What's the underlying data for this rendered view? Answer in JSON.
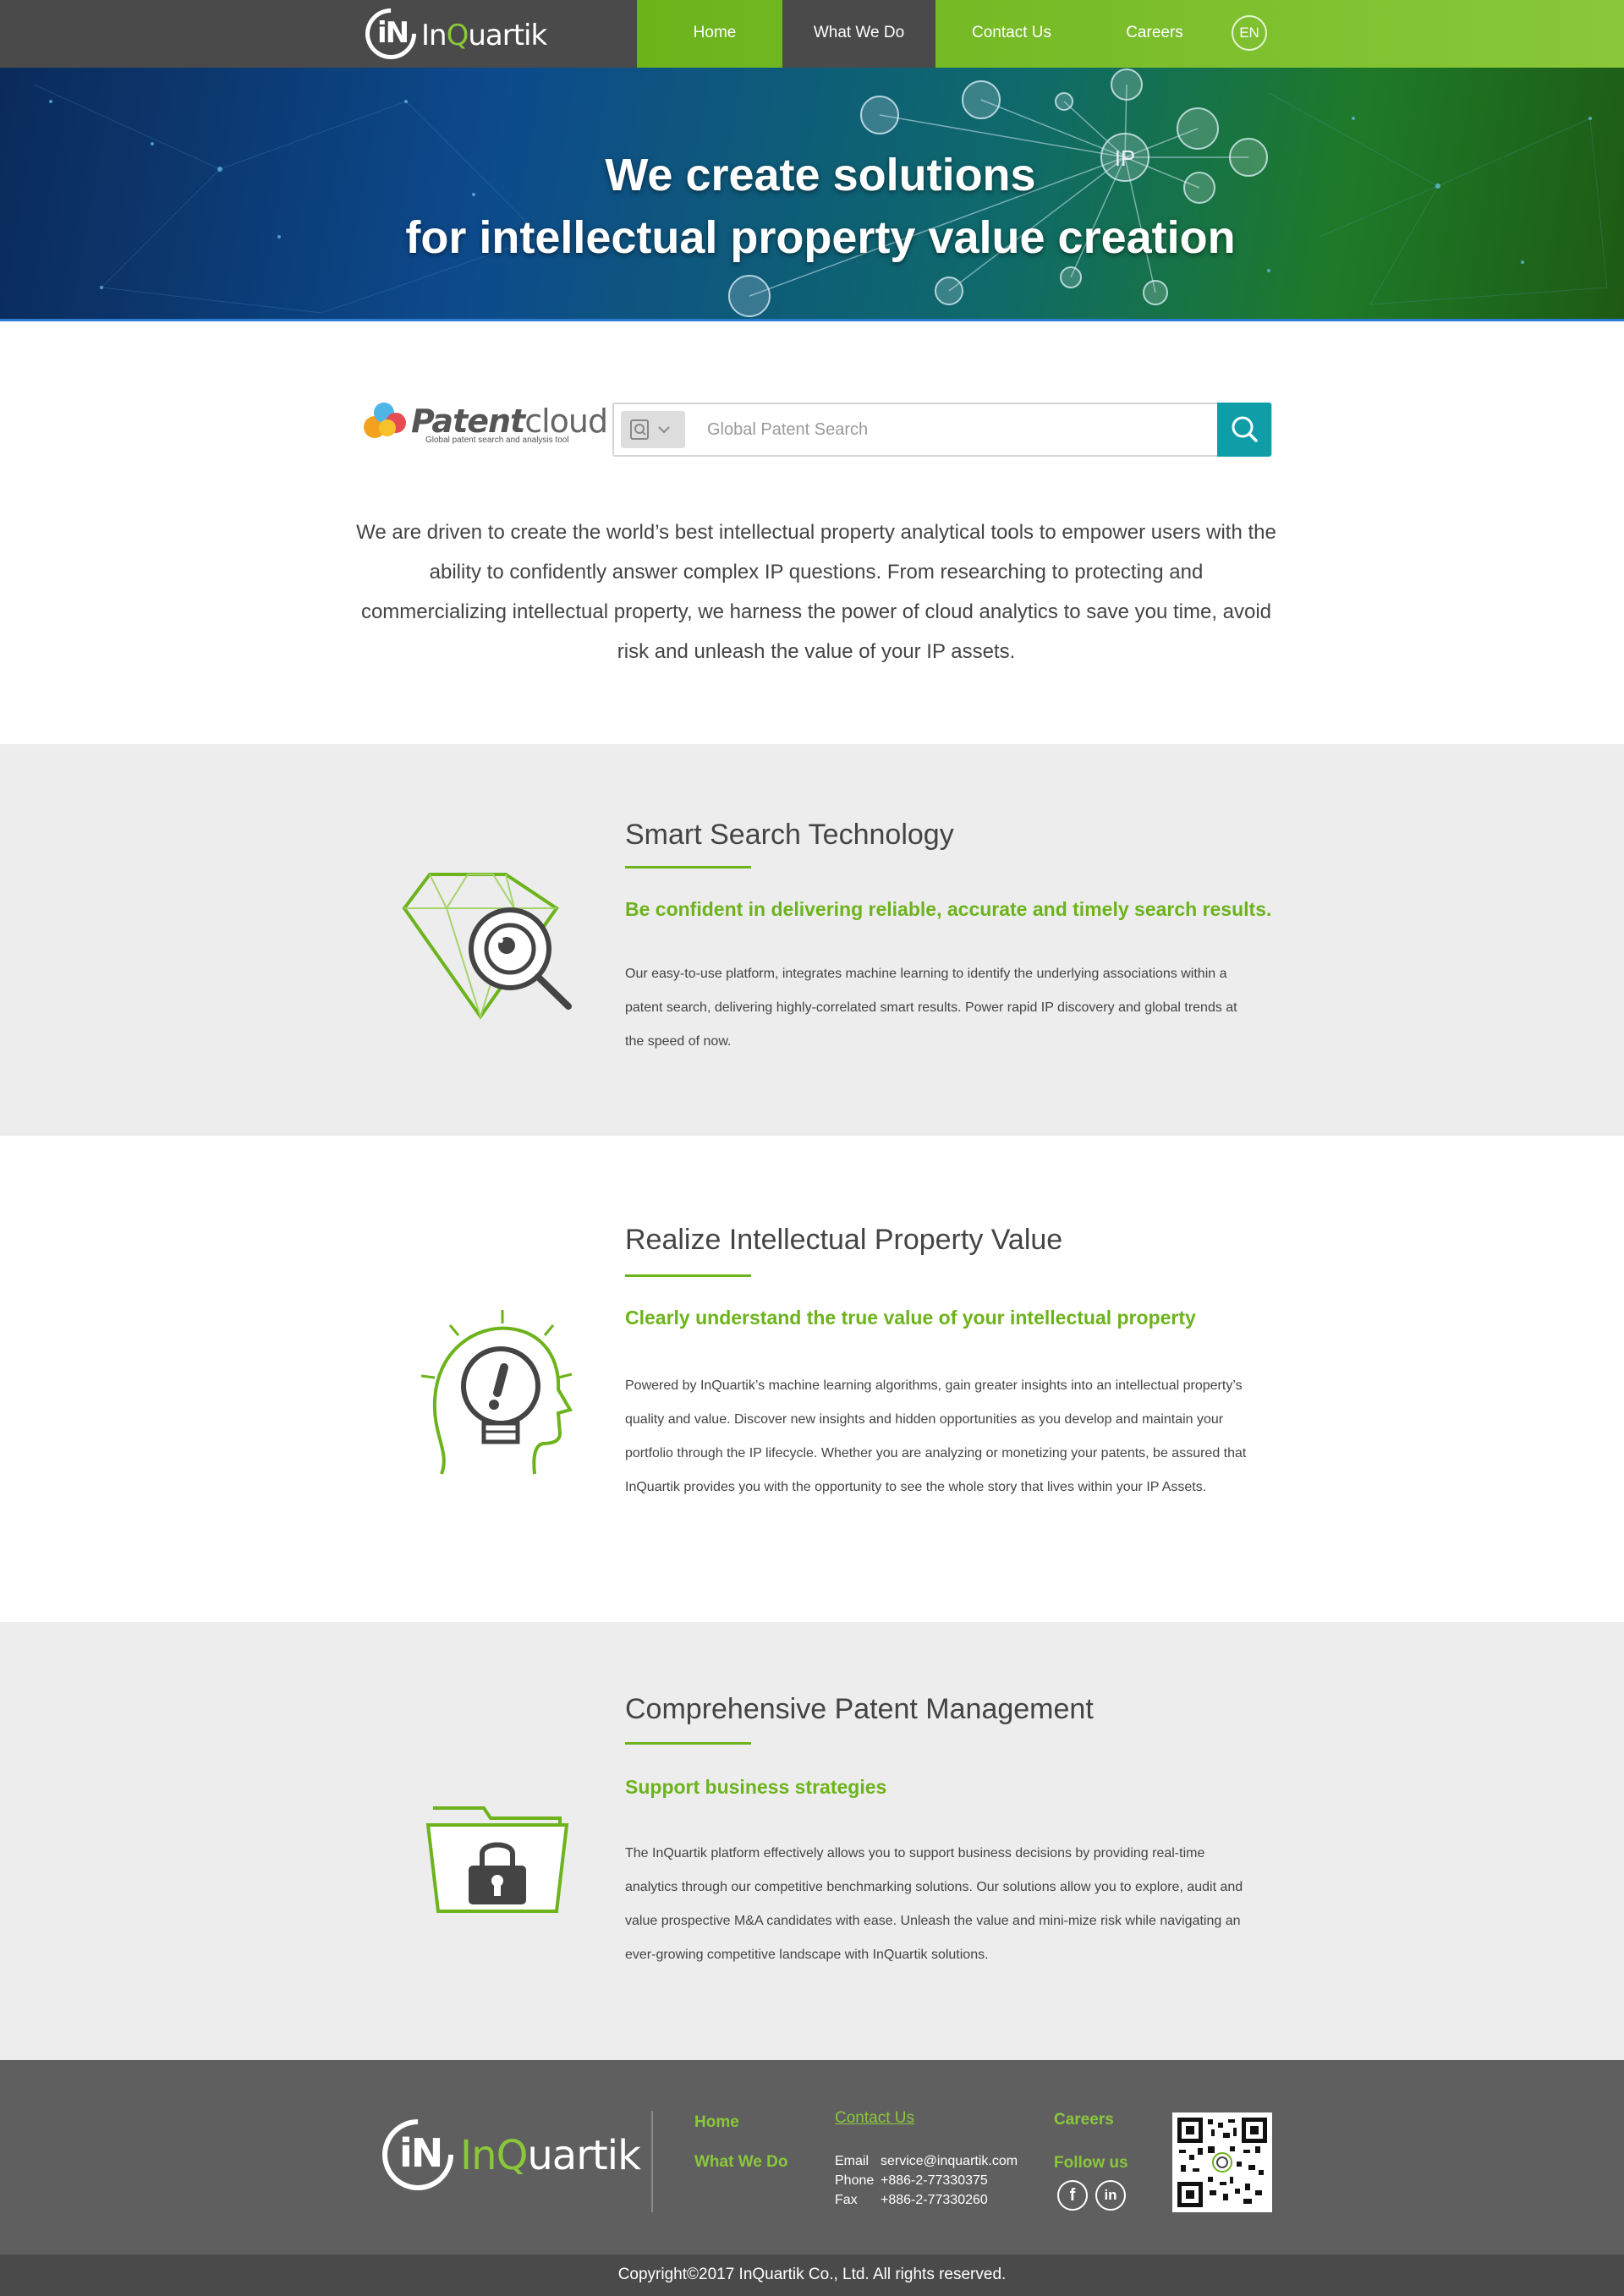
{
  "nav": {
    "logo_text": "InQuartik",
    "items": [
      {
        "label": "Home"
      },
      {
        "label": "What We Do"
      },
      {
        "label": "Contact Us"
      },
      {
        "label": "Careers"
      }
    ],
    "active": "What We Do",
    "language": "EN"
  },
  "hero": {
    "line1": "We create solutions",
    "line2": "for intellectual property value creation",
    "hub_label": "IP"
  },
  "search": {
    "brand": "Patentcloud",
    "brand_bold": "Patent",
    "brand_light": "cloud",
    "tagline": "Global patent search and analysis tool",
    "placeholder": "Global Patent Search"
  },
  "intro": "We are driven to create the world’s best intellectual property analytical tools to empower users with the ability to confidently answer complex IP questions. From researching to protecting and commercializing intellectual property, we harness the power of cloud analytics to save you time, avoid risk and unleash the value of your IP assets.",
  "sections": [
    {
      "title": "Smart Search Technology",
      "subtitle": "Be confident in delivering reliable, accurate and timely search results.",
      "body": "Our easy-to-use platform, integrates machine learning to identify the underlying associations within a patent search, delivering highly-correlated smart results. Power rapid IP discovery and global trends at the speed of now.",
      "icon": "diamond-magnifier-icon"
    },
    {
      "title": "Realize Intellectual Property Value",
      "subtitle": "Clearly understand the true value of your intellectual property",
      "body": "Powered by InQuartik’s machine learning algorithms, gain greater insights into an intellectual property’s quality and value. Discover new insights and hidden opportunities as you develop and maintain your portfolio through the IP lifecycle. Whether you are analyzing or monetizing your patents, be assured that InQuartik provides you with the opportunity to see the whole story that lives within your IP Assets.",
      "icon": "head-lightbulb-icon"
    },
    {
      "title": "Comprehensive Patent Management",
      "subtitle": "Support business strategies",
      "body": "The InQuartik platform effectively allows you to support business decisions by providing real-time analytics through our competitive benchmarking solutions. Our solutions allow you to explore, audit and value prospective M&A candidates with ease. Unleash the value and mini-mize risk while navigating an ever-growing competitive landscape with InQuartik solutions.",
      "icon": "folder-lock-icon"
    }
  ],
  "footer": {
    "logo_text": "InQuartik",
    "links": {
      "home": "Home",
      "what_we_do": "What We Do",
      "careers": "Careers",
      "follow": "Follow us"
    },
    "contact_title": "Contact Us",
    "email_label": "Email",
    "email": "service@inquartik.com",
    "phone_label": "Phone",
    "phone": "+886-2-77330375",
    "fax_label": "Fax",
    "fax": "+886-2-77330260",
    "social": [
      "f",
      "in"
    ]
  },
  "copyright": "Copyright©2017 InQuartik Co., Ltd. All rights reserved.",
  "colors": {
    "brand_green": "#6cb31c",
    "nav_dark": "#4a4a4a",
    "search_teal": "#0f9da8",
    "footer_grey": "#5f5f60"
  }
}
